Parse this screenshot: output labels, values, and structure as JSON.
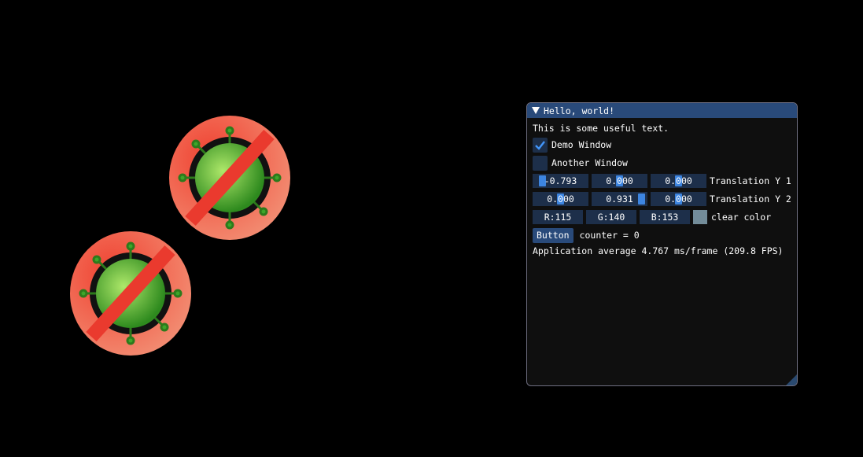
{
  "window": {
    "title": "Hello, world!",
    "text": "This is some useful text.",
    "checkboxes": [
      {
        "label": "Demo Window",
        "checked": true
      },
      {
        "label": "Another Window",
        "checked": false
      }
    ],
    "translation1": {
      "values": [
        "-0.793",
        "0.000",
        "0.000"
      ],
      "label": "Translation Y 1"
    },
    "translation2": {
      "values": [
        "0.000",
        "0.931",
        "0.000"
      ],
      "label": "Translation Y 2"
    },
    "clear_color": {
      "r": "R:115",
      "g": "G:140",
      "b": "B:153",
      "label": "clear color",
      "swatch": "#738c99"
    },
    "button_label": "Button",
    "counter_text": "counter = 0",
    "fps_text": "Application average 4.767 ms/frame (209.8 FPS)"
  },
  "colors": {
    "window_bg": "#0f0f0f",
    "title_bg": "#294a7a",
    "frame_bg": "#1d2f4a",
    "accent": "#3d85e0"
  },
  "icons": [
    "no-virus-icon",
    "checkmark-icon",
    "collapse-arrow-icon",
    "resize-grip-icon"
  ]
}
